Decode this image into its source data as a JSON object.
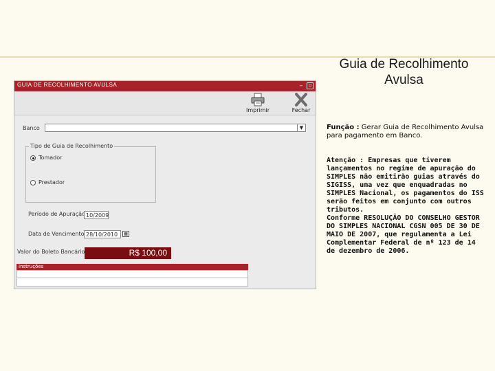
{
  "slide": {
    "title": "Guia de Recolhimento Avulsa",
    "funcao_label": "Função :",
    "funcao_text": " Gerar Guia de Recolhimento Avulsa para pagamento em Banco.",
    "atencao_1": "Atenção : Empresas que tiverem lançamentos no regime de apuração do SIMPLES não emitirão guias através do SIGISS, uma vez que enquadradas no SIMPLES Nacional, os pagamentos do ISS serão feitos em conjunto com outros tributos.",
    "atencao_2": "Conforme RESOLUÇÃO DO CONSELHO GESTOR DO SIMPLES NACIONAL CGSN 005 DE 30 DE MAIO DE 2007, que regulamenta a Lei Complementar Federal de nº 123 de 14 de dezembro de 2006."
  },
  "window": {
    "title": "GUIA DE RECOLHIMENTO AVULSA",
    "toolbar": {
      "print_label": "Imprimir",
      "close_label": "Fechar"
    },
    "form": {
      "banco_label": "Banco",
      "banco_value": "",
      "tipo_legend": "Tipo de Guia de Recolhimento",
      "radio_tomador": "Tomador",
      "radio_prestador": "Prestador",
      "selected": "Tomador",
      "periodo_label": "Período de Apuração",
      "periodo_value": "10/2009",
      "vencimento_label": "Data de Vencimento",
      "vencimento_value": "28/10/2010",
      "valor_label": "Valor do Boleto Bancário",
      "valor_value": "R$ 100,00",
      "instrucoes_label": "Instruções"
    }
  },
  "colors": {
    "titlebar": "#a8222a",
    "amount_bg": "#7a0d12",
    "slide_bg": "#fdfaf0"
  }
}
